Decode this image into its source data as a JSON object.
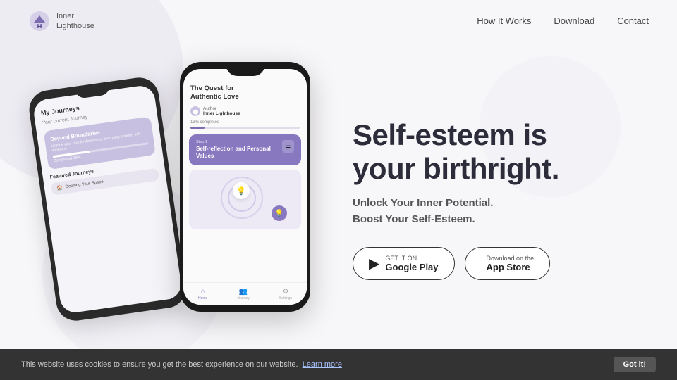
{
  "nav": {
    "logo_line1": "Inner",
    "logo_line2": "Lighthouse",
    "links": [
      {
        "label": "How It Works",
        "href": "#"
      },
      {
        "label": "Download",
        "href": "#"
      },
      {
        "label": "Contact",
        "href": "#"
      }
    ]
  },
  "phone_back": {
    "title": "My Journeys",
    "current_journey_label": "Your current Journey",
    "card_title": "Beyond Boundaries",
    "card_sub": "Unlock your true limitlessness, everyday sounds self-welcome",
    "progress_label": "Completed 39%",
    "featured_label": "Featured Journeys",
    "small_card_text": "Defining Your Space"
  },
  "phone_front": {
    "title_line1": "The Quest for",
    "title_line2": "Authentic Love",
    "author_label": "Author",
    "author_name": "Inner Lighthouse",
    "progress_label": "13% completed",
    "step_label": "Step 1",
    "step_title": "Self-reflection and Personal Values",
    "tab_home": "Home",
    "tab_journey": "Journey",
    "tab_settings": "Settings"
  },
  "hero": {
    "heading_line1": "Self-esteem is",
    "heading_line2": "your birthright.",
    "sub_line1": "Unlock Your Inner Potential.",
    "sub_line2": "Boost Your Self-Esteem.",
    "btn_google_top": "GET IT ON",
    "btn_google_name": "Google Play",
    "btn_apple_top": "Download on the",
    "btn_apple_name": "App Store"
  },
  "cookie": {
    "text": "This website uses cookies to ensure you get the best experience on our website.",
    "link_text": "Learn more",
    "btn_label": "Got it!"
  }
}
